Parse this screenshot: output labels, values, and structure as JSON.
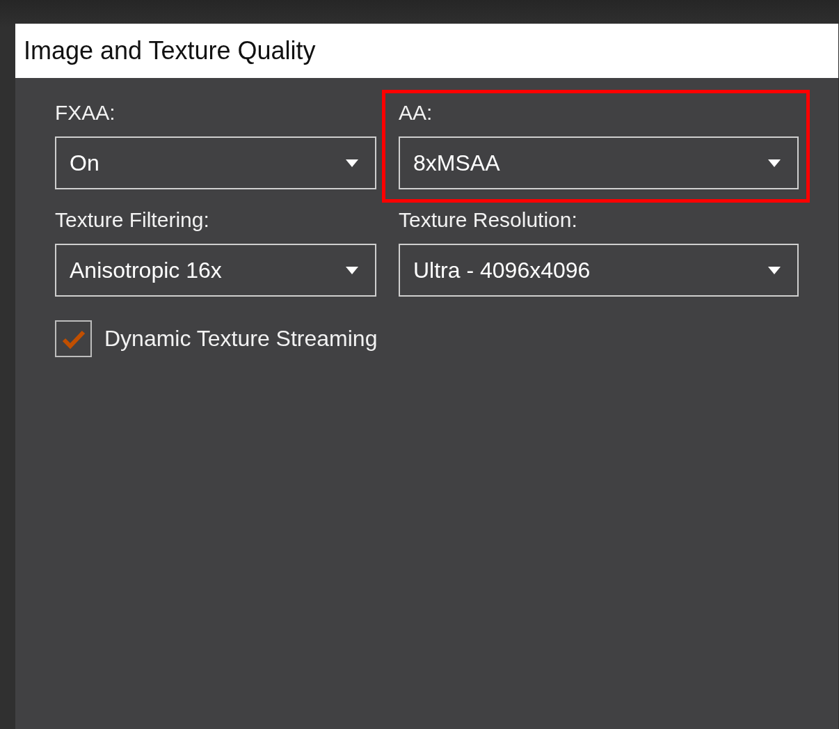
{
  "window": {
    "title": "Image and Texture Quality"
  },
  "settings": [
    {
      "label": "FXAA:",
      "value": "On",
      "highlighted": false
    },
    {
      "label": "AA:",
      "value": "8xMSAA",
      "highlighted": true
    },
    {
      "label": "Texture Filtering:",
      "value": "Anisotropic 16x",
      "highlighted": false
    },
    {
      "label": "Texture Resolution:",
      "value": "Ultra - 4096x4096",
      "highlighted": false
    }
  ],
  "checkbox": {
    "label": "Dynamic Texture Streaming",
    "checked": true
  }
}
